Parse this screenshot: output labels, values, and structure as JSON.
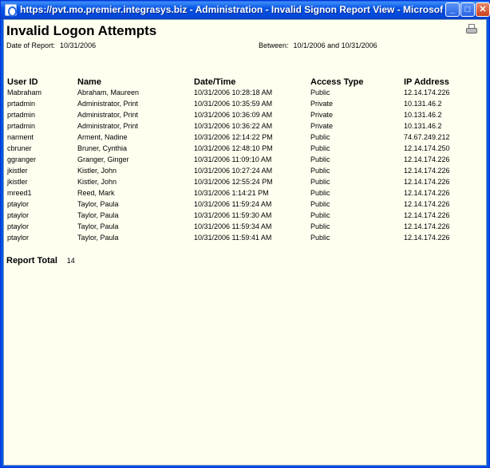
{
  "window": {
    "title": "https://pvt.mo.premier.integrasys.biz - Administration - Invalid Signon Report View - Microsoft Internet Expl...",
    "min_label": "_",
    "max_label": "□",
    "close_label": "✕"
  },
  "report": {
    "title": "Invalid Logon Attempts",
    "date_label": "Date of Report:",
    "date_value": "10/31/2006",
    "between_label": "Between:",
    "between_value": "10/1/2006 and 10/31/2006",
    "columns": [
      "User ID",
      "Name",
      "Date/Time",
      "Access Type",
      "IP Address"
    ],
    "rows": [
      [
        "Mabraham",
        "Abraham, Maureen",
        "10/31/2006 10:28:18 AM",
        "Public",
        "12.14.174.226"
      ],
      [
        "prtadmin",
        "Administrator, Print",
        "10/31/2006 10:35:59 AM",
        "Private",
        "10.131.46.2"
      ],
      [
        "prtadmin",
        "Administrator, Print",
        "10/31/2006 10:36:09 AM",
        "Private",
        "10.131.46.2"
      ],
      [
        "prtadmin",
        "Administrator, Print",
        "10/31/2006 10:36:22 AM",
        "Private",
        "10.131.46.2"
      ],
      [
        "narment",
        "Arment, Nadine",
        "10/31/2006 12:14:22 PM",
        "Public",
        "74.67.249.212"
      ],
      [
        "cbruner",
        "Bruner, Cynthia",
        "10/31/2006 12:48:10 PM",
        "Public",
        "12.14.174.250"
      ],
      [
        "ggranger",
        "Granger, Ginger",
        "10/31/2006 11:09:10 AM",
        "Public",
        "12.14.174.226"
      ],
      [
        "jkistler",
        "Kistler, John",
        "10/31/2006 10:27:24 AM",
        "Public",
        "12.14.174.226"
      ],
      [
        "jkistler",
        "Kistler, John",
        "10/31/2006 12:55:24 PM",
        "Public",
        "12.14.174.226"
      ],
      [
        "mreed1",
        "Reed, Mark",
        "10/31/2006 1:14:21 PM",
        "Public",
        "12.14.174.226"
      ],
      [
        "ptaylor",
        "Taylor, Paula",
        "10/31/2006 11:59:24 AM",
        "Public",
        "12.14.174.226"
      ],
      [
        "ptaylor",
        "Taylor, Paula",
        "10/31/2006 11:59:30 AM",
        "Public",
        "12.14.174.226"
      ],
      [
        "ptaylor",
        "Taylor, Paula",
        "10/31/2006 11:59:34 AM",
        "Public",
        "12.14.174.226"
      ],
      [
        "ptaylor",
        "Taylor, Paula",
        "10/31/2006 11:59:41 AM",
        "Public",
        "12.14.174.226"
      ]
    ],
    "total_label": "Report Total",
    "total_value": "14"
  }
}
